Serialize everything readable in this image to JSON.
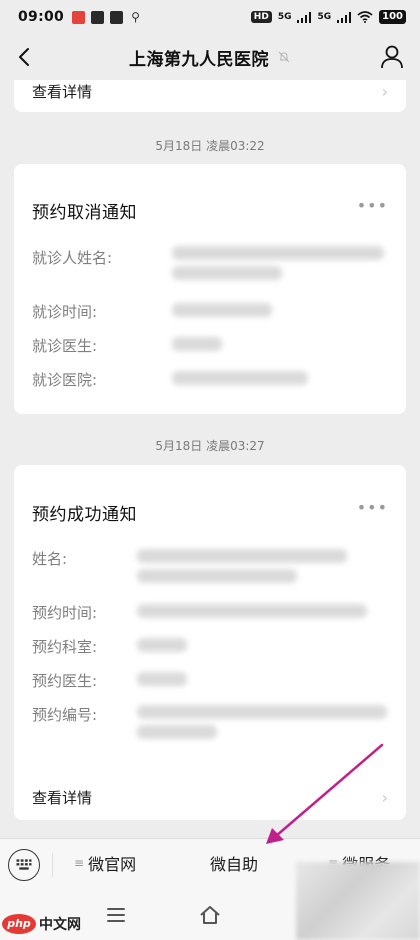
{
  "status_bar": {
    "time": "09:00",
    "notification_icons": [
      "app-icon-red",
      "app-icon-bag",
      "app-icon-k",
      "app-icon-figure"
    ],
    "hd_label": "HD",
    "net1": "5G",
    "net2": "5G",
    "battery": "100"
  },
  "header": {
    "title": "上海第九人民医院"
  },
  "top_card": {
    "link_label": "查看详情"
  },
  "message_1": {
    "timestamp": "5月18日 凌晨03:22",
    "title": "预约取消通知",
    "more": "•••",
    "fields": [
      {
        "label": "就诊人姓名:"
      },
      {
        "label": "就诊时间:"
      },
      {
        "label": "就诊医生:"
      },
      {
        "label": "就诊医院:"
      }
    ]
  },
  "message_2": {
    "timestamp": "5月18日 凌晨03:27",
    "title": "预约成功通知",
    "more": "•••",
    "fields": [
      {
        "label": "姓名:"
      },
      {
        "label": "预约时间:"
      },
      {
        "label": "预约科室:"
      },
      {
        "label": "预约医生:"
      },
      {
        "label": "预约编号:"
      }
    ],
    "link_label": "查看详情"
  },
  "bottom_menu": {
    "items": [
      {
        "label": "微官网",
        "icon": "menu-lines-icon"
      },
      {
        "label": "微自助",
        "icon": ""
      },
      {
        "label": "微服务",
        "icon": "menu-lines-icon"
      }
    ]
  },
  "watermark": {
    "logo": "php",
    "text": "中文网"
  },
  "colors": {
    "background": "#ededed",
    "card": "#ffffff",
    "annotation_arrow": "#c0208a"
  }
}
